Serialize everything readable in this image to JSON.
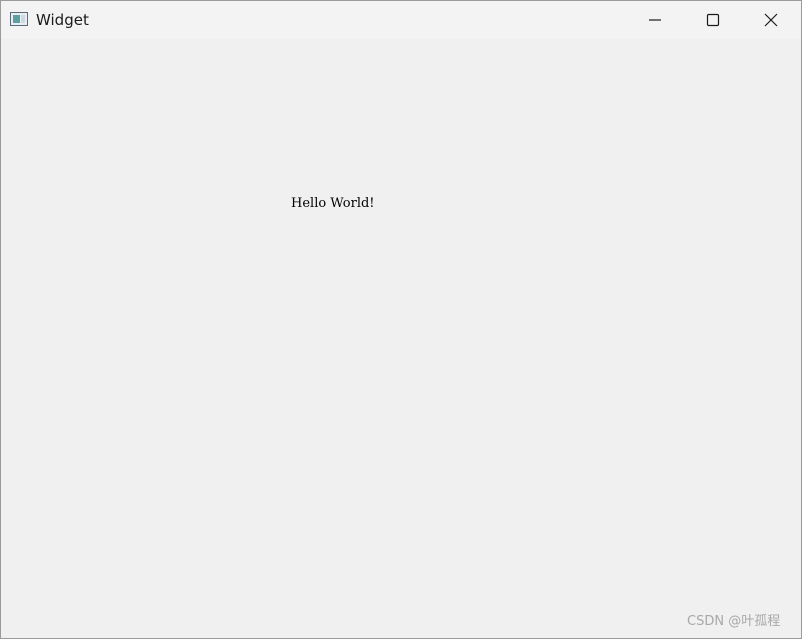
{
  "window": {
    "title": "Widget",
    "icon": "app-window-icon",
    "controls": {
      "minimize_icon": "minimize-icon",
      "maximize_icon": "maximize-icon",
      "close_icon": "close-icon"
    }
  },
  "content": {
    "label_text": "Hello World!"
  },
  "watermark": {
    "text": "CSDN @叶孤程"
  },
  "colors": {
    "titlebar": "#f3f3f3",
    "client_area": "#f0f0f0",
    "text": "#000000",
    "watermark": "#a8a8a8"
  }
}
